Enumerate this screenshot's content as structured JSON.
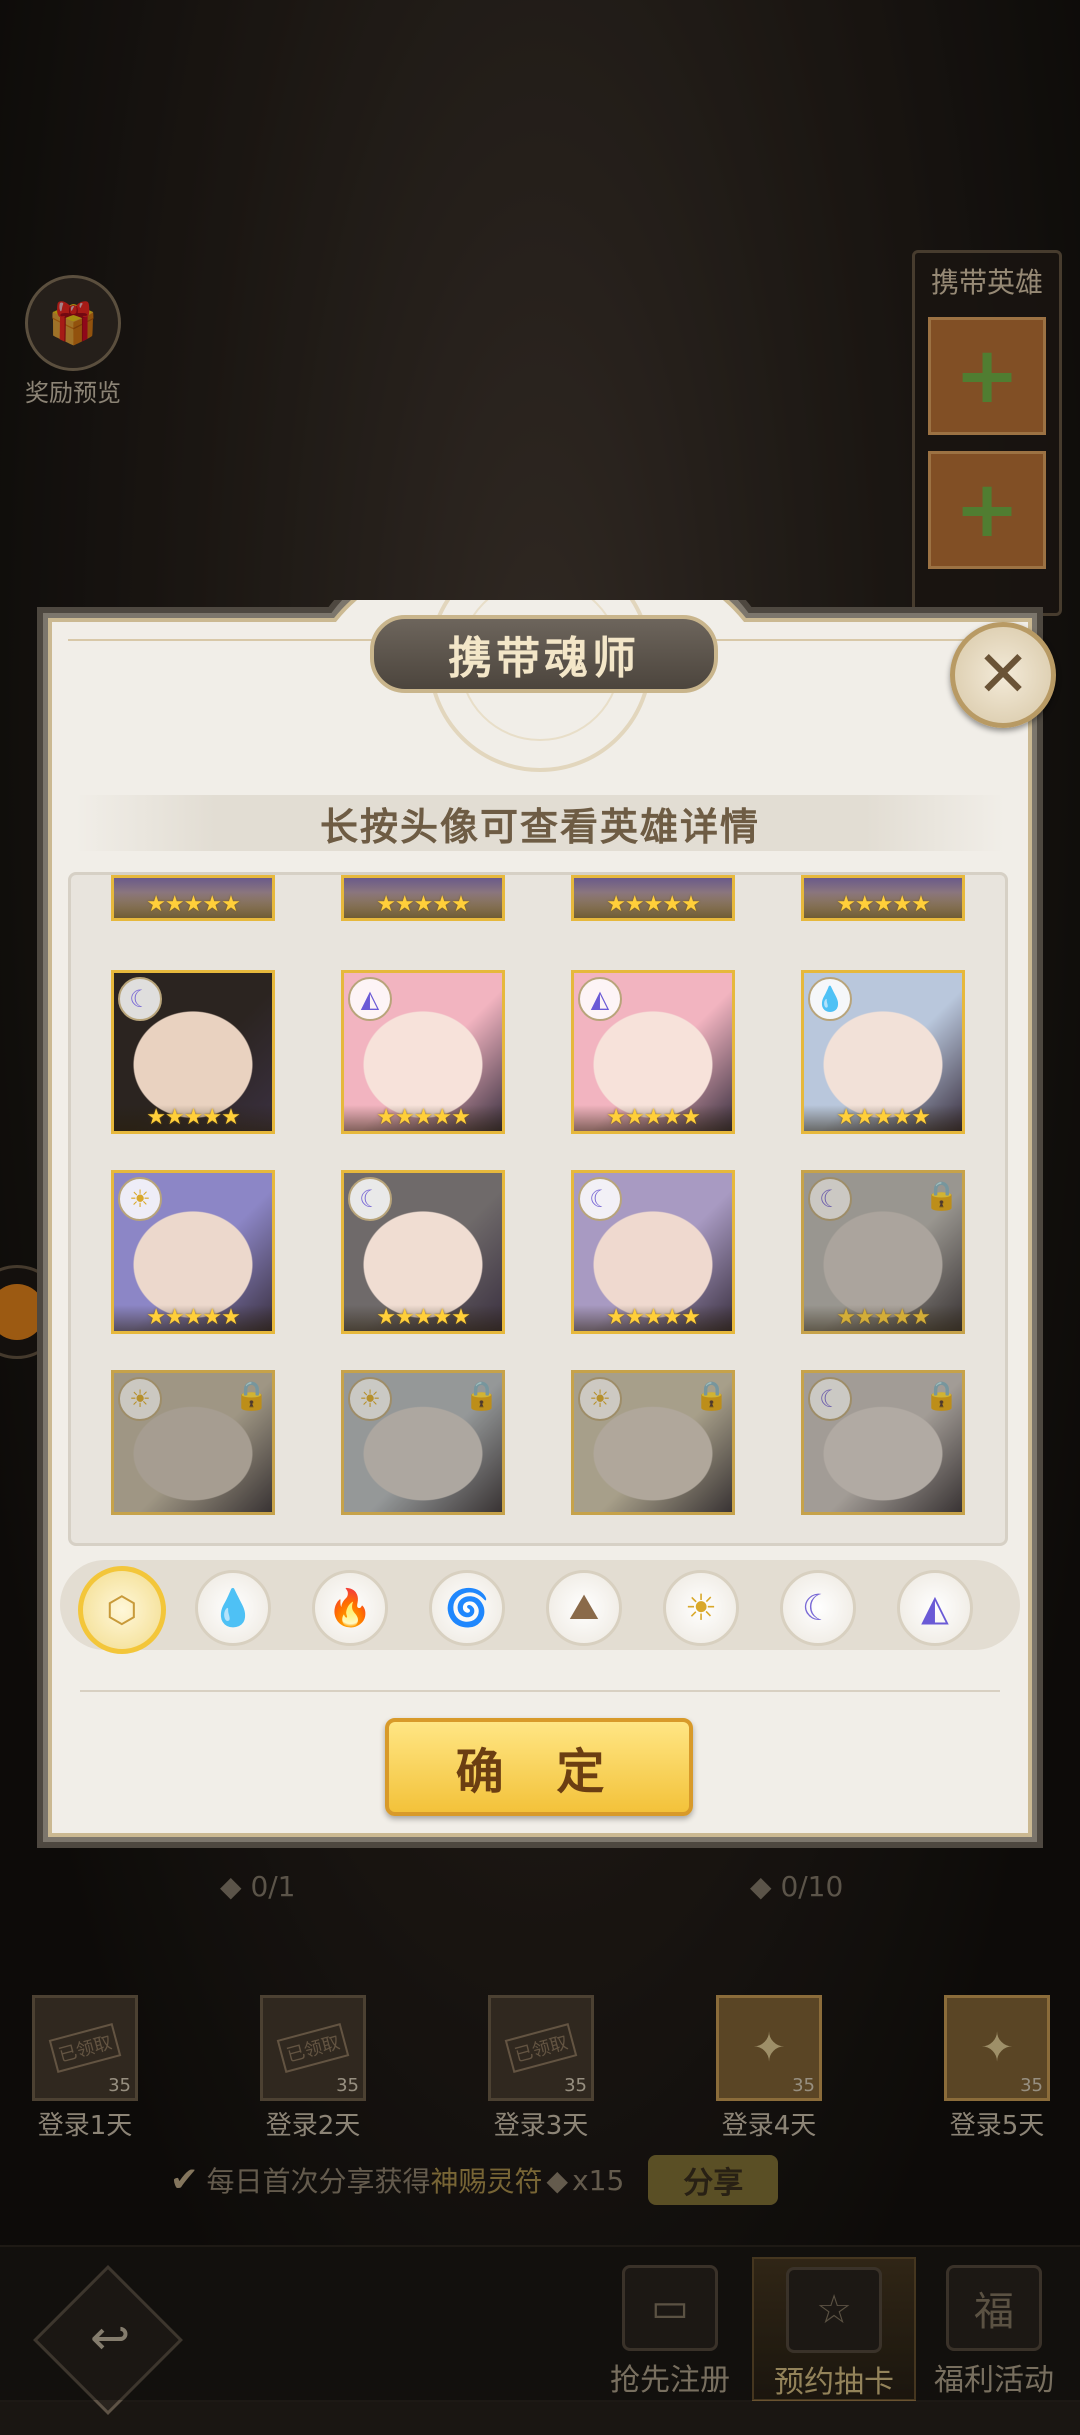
{
  "background": {
    "reward_preview_label": "奖励预览",
    "carry_heroes_title": "携带英雄",
    "progress_left": "0/1",
    "progress_right": "0/10",
    "login_days": [
      {
        "label": "登录1天",
        "qty": "35",
        "status": "已领取"
      },
      {
        "label": "登录2天",
        "qty": "35",
        "status": "已领取"
      },
      {
        "label": "登录3天",
        "qty": "35",
        "status": "已领取"
      },
      {
        "label": "登录4天",
        "qty": "35",
        "status": ""
      },
      {
        "label": "登录5天",
        "qty": "35",
        "status": ""
      }
    ],
    "share_prefix": "每日首次分享获得",
    "share_item": "神赐灵符",
    "share_qty": "x15",
    "share_button": "分享",
    "nav_tabs": [
      "抢先注册",
      "预约抽卡",
      "福利活动"
    ]
  },
  "modal": {
    "title": "携带魂师",
    "subtitle": "长按头像可查看英雄详情",
    "confirm_label": "确 定",
    "filters": [
      {
        "name": "all",
        "icon": "box-icon",
        "glyph": "⬡",
        "color": "#c89a3a"
      },
      {
        "name": "water",
        "icon": "water-icon",
        "glyph": "💧",
        "color": "#3a86d6"
      },
      {
        "name": "fire",
        "icon": "fire-icon",
        "glyph": "🔥",
        "color": "#d94a3a"
      },
      {
        "name": "wind",
        "icon": "wind-icon",
        "glyph": "🌀",
        "color": "#3aa06a"
      },
      {
        "name": "earth",
        "icon": "earth-icon",
        "glyph": "⛰",
        "color": "#8a6a4a"
      },
      {
        "name": "light",
        "icon": "light-icon",
        "glyph": "☀",
        "color": "#d9a82a"
      },
      {
        "name": "dark",
        "icon": "dark-icon",
        "glyph": "☾",
        "color": "#7a6ad6"
      },
      {
        "name": "void",
        "icon": "void-icon",
        "glyph": "◭",
        "color": "#6a5ad6"
      }
    ],
    "heroes": [
      {
        "elem": "dark",
        "stars": "★★★★★",
        "locked": false,
        "hair": "#2b2420",
        "skin": "#e9d2c0"
      },
      {
        "elem": "void",
        "stars": "★★★★★",
        "locked": false,
        "hair": "#f2b4c0",
        "skin": "#f7e2da"
      },
      {
        "elem": "void",
        "stars": "★★★★★",
        "locked": false,
        "hair": "#f2b4c0",
        "skin": "#f7e2da"
      },
      {
        "elem": "water",
        "stars": "★★★★★",
        "locked": false,
        "hair": "#b9c7dc",
        "skin": "#f2e1d8"
      },
      {
        "elem": "light",
        "stars": "★★★★★",
        "locked": false,
        "hair": "#8c86c6",
        "skin": "#ecd8cc"
      },
      {
        "elem": "dark",
        "stars": "★★★★★",
        "locked": false,
        "hair": "#6f6a6a",
        "skin": "#f0ddd2"
      },
      {
        "elem": "dark",
        "stars": "★★★★★",
        "locked": false,
        "hair": "#a89ac2",
        "skin": "#efd9cf"
      },
      {
        "elem": "dark",
        "stars": "★★★★★",
        "locked": true,
        "hair": "#c8c4c0",
        "skin": "#e6d8d0"
      },
      {
        "elem": "light",
        "stars": "",
        "locked": true,
        "hair": "#d8c49c",
        "skin": "#e2cdb8"
      },
      {
        "elem": "light",
        "stars": "",
        "locked": true,
        "hair": "#b8c8d8",
        "skin": "#e8dcd6"
      },
      {
        "elem": "light",
        "stars": "",
        "locked": true,
        "hair": "#e4d2a0",
        "skin": "#efdcc8"
      },
      {
        "elem": "dark",
        "stars": "",
        "locked": true,
        "hair": "#d8ccc8",
        "skin": "#f0e0da"
      }
    ],
    "partial_row_stars": "★★★★★"
  }
}
